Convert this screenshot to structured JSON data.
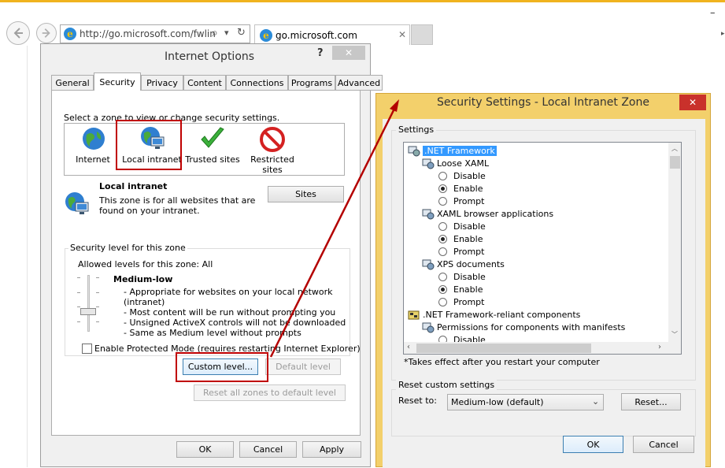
{
  "browser": {
    "address": "http://go.microsoft.com/fwlin",
    "address_host_highlight": "go.microsoft.com",
    "tab_title": "go.microsoft.com",
    "minimize_glyph": "–",
    "address_icons": {
      "search": "⌕",
      "dropdown": "▾",
      "refresh": "↻"
    }
  },
  "internet_options": {
    "title": "Internet Options",
    "help": "?",
    "tabs": [
      "General",
      "Security",
      "Privacy",
      "Content",
      "Connections",
      "Programs",
      "Advanced"
    ],
    "active_tab": "Security",
    "zone_prompt": "Select a zone to view or change security settings.",
    "zones": [
      {
        "label": "Internet",
        "icon": "globe-icon"
      },
      {
        "label": "Local intranet",
        "icon": "intranet-icon"
      },
      {
        "label": "Trusted sites",
        "icon": "checkmark-icon"
      },
      {
        "label": "Restricted sites",
        "icon": "restricted-icon"
      }
    ],
    "zone_title": "Local intranet",
    "zone_desc_line1": "This zone is for all websites that are",
    "zone_desc_line2": "found on your intranet.",
    "sites_button": "Sites",
    "security_level_legend": "Security level for this zone",
    "allowed_levels": "Allowed levels for this zone: All",
    "level_name": "Medium-low",
    "level_bullets": [
      "- Appropriate for websites on your local network",
      "(intranet)",
      "- Most content will be run without prompting you",
      "- Unsigned ActiveX controls will not be downloaded",
      "- Same as Medium level without prompts"
    ],
    "protected_mode_label": "Enable Protected Mode (requires restarting Internet Explorer)",
    "custom_level_button": "Custom level...",
    "default_level_button": "Default level",
    "reset_all_button": "Reset all zones to default level",
    "ok": "OK",
    "cancel": "Cancel",
    "apply": "Apply"
  },
  "security_settings": {
    "title": "Security Settings - Local Intranet Zone",
    "close": "✕",
    "settings_legend": "Settings",
    "tree": [
      {
        "kind": "group",
        "label": ".NET Framework",
        "selected": true
      },
      {
        "kind": "setting",
        "label": "Loose XAML"
      },
      {
        "kind": "radio",
        "label": "Disable",
        "checked": false
      },
      {
        "kind": "radio",
        "label": "Enable",
        "checked": true
      },
      {
        "kind": "radio",
        "label": "Prompt",
        "checked": false
      },
      {
        "kind": "setting",
        "label": "XAML browser applications"
      },
      {
        "kind": "radio",
        "label": "Disable",
        "checked": false
      },
      {
        "kind": "radio",
        "label": "Enable",
        "checked": true
      },
      {
        "kind": "radio",
        "label": "Prompt",
        "checked": false
      },
      {
        "kind": "setting",
        "label": "XPS documents"
      },
      {
        "kind": "radio",
        "label": "Disable",
        "checked": false
      },
      {
        "kind": "radio",
        "label": "Enable",
        "checked": true
      },
      {
        "kind": "radio",
        "label": "Prompt",
        "checked": false
      },
      {
        "kind": "group",
        "label": ".NET Framework-reliant components",
        "selected": false
      },
      {
        "kind": "setting",
        "label": "Permissions for components with manifests"
      },
      {
        "kind": "radio",
        "label": "Disable",
        "checked": false
      }
    ],
    "restart_note": "*Takes effect after you restart your computer",
    "reset_legend": "Reset custom settings",
    "reset_to_label": "Reset to:",
    "reset_to_value": "Medium-low (default)",
    "reset_button": "Reset...",
    "ok": "OK",
    "cancel": "Cancel"
  },
  "colors": {
    "highlight_red": "#c00000",
    "dialog_frame": "#f3d06b",
    "selection_blue": "#3399ff"
  }
}
